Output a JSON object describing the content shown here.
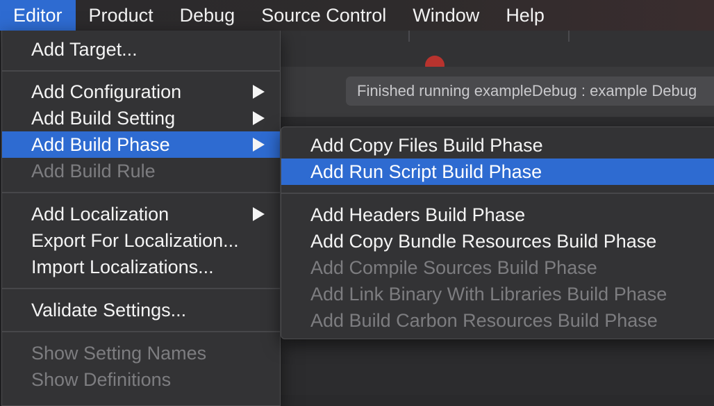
{
  "menubar": {
    "items": [
      {
        "label": "Editor"
      },
      {
        "label": "Product"
      },
      {
        "label": "Debug"
      },
      {
        "label": "Source Control"
      },
      {
        "label": "Window"
      },
      {
        "label": "Help"
      }
    ]
  },
  "window": {
    "status": "Finished running exampleDebug : example Debug"
  },
  "editor_menu": {
    "items": [
      {
        "label": "Add Target..."
      },
      {
        "label": "Add Configuration",
        "submenu": true
      },
      {
        "label": "Add Build Setting",
        "submenu": true
      },
      {
        "label": "Add Build Phase",
        "submenu": true,
        "highlighted": true
      },
      {
        "label": "Add Build Rule",
        "disabled": true
      },
      {
        "label": "Add Localization",
        "submenu": true
      },
      {
        "label": "Export For Localization..."
      },
      {
        "label": "Import Localizations..."
      },
      {
        "label": "Validate Settings..."
      },
      {
        "label": "Show Setting Names",
        "disabled": true
      },
      {
        "label": "Show Definitions",
        "disabled": true
      }
    ]
  },
  "build_phase_submenu": {
    "items": [
      {
        "label": "Add Copy Files Build Phase"
      },
      {
        "label": "Add Run Script Build Phase",
        "highlighted": true
      },
      {
        "label": "Add Headers Build Phase"
      },
      {
        "label": "Add Copy Bundle Resources Build Phase"
      },
      {
        "label": "Add Compile Sources Build Phase",
        "disabled": true
      },
      {
        "label": "Add Link Binary With Libraries Build Phase",
        "disabled": true
      },
      {
        "label": "Add Build Carbon Resources Build Phase",
        "disabled": true
      }
    ]
  },
  "colors": {
    "accent": "#2e6bd1",
    "menu_bg": "#333335",
    "disabled_text": "#7d7d80"
  }
}
